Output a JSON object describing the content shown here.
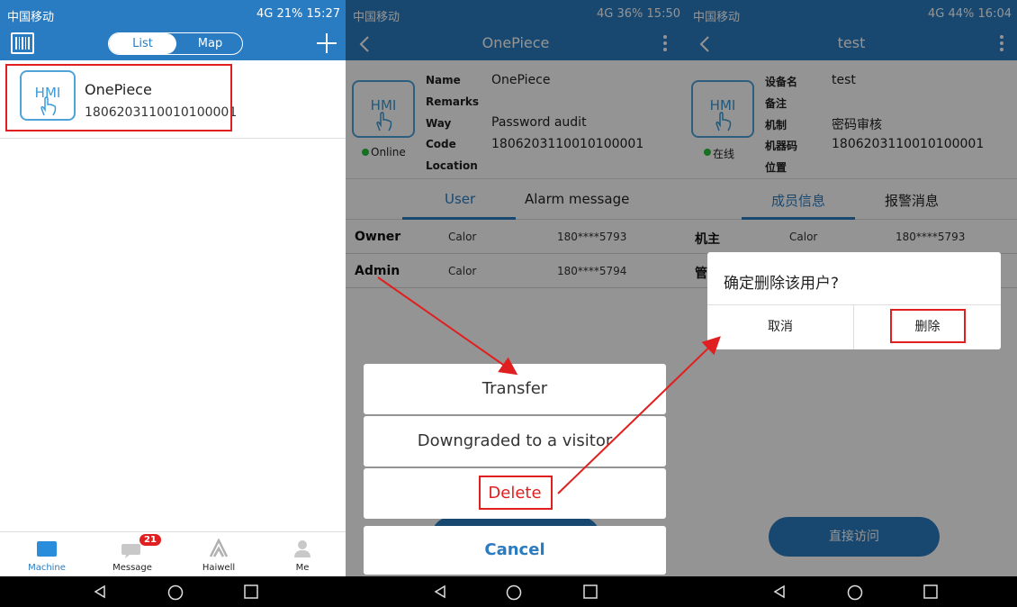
{
  "left": {
    "status": {
      "carrier": "中国移动",
      "right": "4G 21% 15:27"
    },
    "toolbar": {
      "tab_list": "List",
      "tab_map": "Map"
    },
    "device": {
      "hmi": "HMI",
      "name": "OnePiece",
      "code": "1806203110010100001"
    },
    "bottom_tabs": {
      "machine": "Machine",
      "message": "Message",
      "message_badge": "21",
      "haiwell": "Haiwell",
      "me": "Me"
    }
  },
  "middle": {
    "status": {
      "carrier": "中国移动",
      "right": "4G 36% 15:50"
    },
    "title": "OnePiece",
    "hmi": "HMI",
    "online": "Online",
    "labels": {
      "name": "Name",
      "remarks": "Remarks",
      "way": "Way",
      "code": "Code",
      "location": "Location"
    },
    "values": {
      "name": "OnePiece",
      "way": "Password audit",
      "code": "1806203110010100001"
    },
    "tabs": {
      "user": "User",
      "alarm": "Alarm message"
    },
    "rows": [
      {
        "role": "Owner",
        "name": "Calor",
        "phone": "180****5793"
      },
      {
        "role": "Admin",
        "name": "Calor",
        "phone": "180****5794"
      }
    ],
    "sheet": {
      "transfer": "Transfer",
      "downgrade": "Downgraded to a visitor",
      "delete": "Delete",
      "cancel": "Cancel"
    }
  },
  "right": {
    "status": {
      "carrier": "中国移动",
      "right": "4G 44% 16:04"
    },
    "title": "test",
    "hmi": "HMI",
    "online": "在线",
    "labels": {
      "name": "设备名",
      "remarks": "备注",
      "way": "机制",
      "code": "机器码",
      "location": "位置"
    },
    "values": {
      "name": "test",
      "way": "密码审核",
      "code": "1806203110010100001"
    },
    "tabs": {
      "user": "成员信息",
      "alarm": "报警消息"
    },
    "rows": [
      {
        "role": "机主",
        "name": "Calor",
        "phone": "180****5793"
      },
      {
        "role": "管"
      }
    ],
    "dialog": {
      "title": "确定删除该用户?",
      "cancel": "取消",
      "confirm": "删除"
    },
    "access_button": "直接访问"
  },
  "colors": {
    "accent": "#2a7cc2",
    "highlight": "#e02020",
    "online": "#27c23a"
  }
}
